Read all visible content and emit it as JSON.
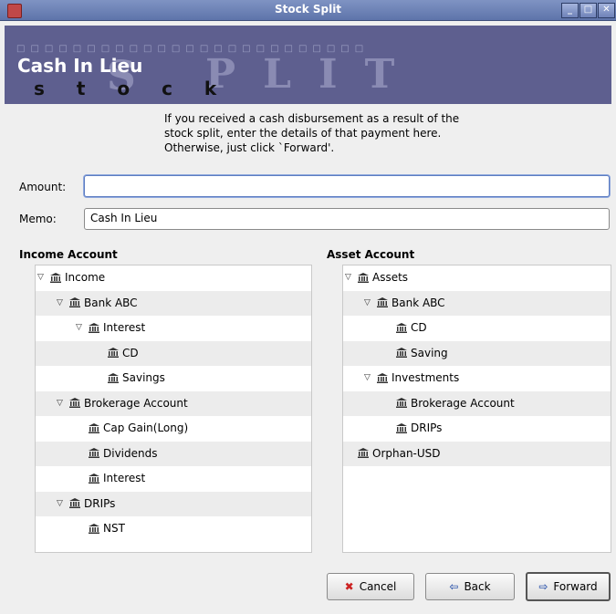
{
  "window": {
    "title": "Stock Split"
  },
  "banner": {
    "title": "Cash In Lieu",
    "decor_letters": "s  t  o  c  k",
    "bg_letters": "PLIT",
    "bg_s": "S"
  },
  "instructions": "If you received a cash disbursement as a result of the stock split, enter the details of that payment here. Otherwise, just click `Forward'.",
  "form": {
    "amount_label": "Amount:",
    "amount_value": "",
    "memo_label": "Memo:",
    "memo_value": "Cash In Lieu"
  },
  "income": {
    "label": "Income Account",
    "rows": [
      {
        "label": "Income",
        "depth": 0,
        "expanded": true
      },
      {
        "label": "Bank ABC",
        "depth": 1,
        "expanded": true
      },
      {
        "label": "Interest",
        "depth": 2,
        "expanded": true
      },
      {
        "label": "CD",
        "depth": 3,
        "expanded": false
      },
      {
        "label": "Savings",
        "depth": 3,
        "expanded": false
      },
      {
        "label": "Brokerage Account",
        "depth": 1,
        "expanded": true
      },
      {
        "label": "Cap Gain(Long)",
        "depth": 2,
        "expanded": false
      },
      {
        "label": "Dividends",
        "depth": 2,
        "expanded": false
      },
      {
        "label": "Interest",
        "depth": 2,
        "expanded": false
      },
      {
        "label": "DRIPs",
        "depth": 1,
        "expanded": true
      },
      {
        "label": "NST",
        "depth": 2,
        "expanded": false
      }
    ]
  },
  "asset": {
    "label": "Asset Account",
    "rows": [
      {
        "label": "Assets",
        "depth": 0,
        "expanded": true
      },
      {
        "label": "Bank ABC",
        "depth": 1,
        "expanded": true
      },
      {
        "label": "CD",
        "depth": 2,
        "expanded": false
      },
      {
        "label": "Saving",
        "depth": 2,
        "expanded": false
      },
      {
        "label": "Investments",
        "depth": 1,
        "expanded": true
      },
      {
        "label": "Brokerage Account",
        "depth": 2,
        "expanded": false
      },
      {
        "label": "DRIPs",
        "depth": 2,
        "expanded": false
      },
      {
        "label": "Orphan-USD",
        "depth": 0,
        "expanded": false
      }
    ]
  },
  "buttons": {
    "cancel": "Cancel",
    "back": "Back",
    "forward": "Forward"
  }
}
